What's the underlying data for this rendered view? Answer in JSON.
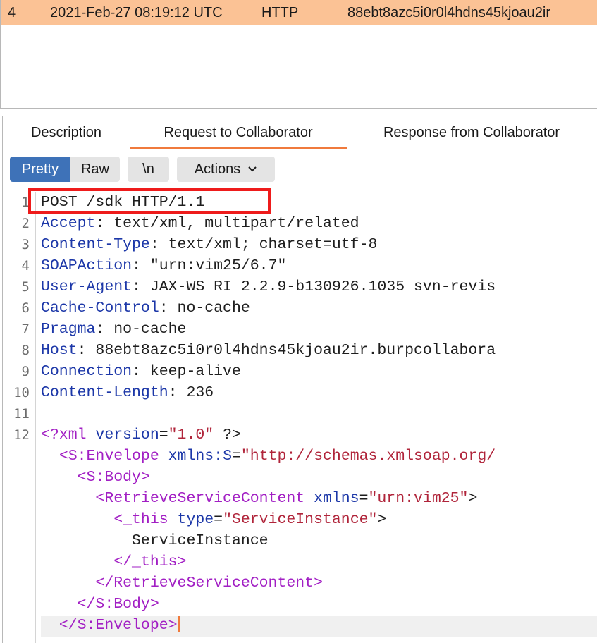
{
  "interactions": {
    "selected_row": {
      "number": "4",
      "time": "2021-Feb-27 08:19:12 UTC",
      "type": "HTTP",
      "payload": "88ebt8azc5i0r0l4hdns45kjoau2ir"
    }
  },
  "tabs": {
    "description": "Description",
    "request": "Request to Collaborator",
    "response": "Response from Collaborator",
    "active": "request"
  },
  "toolbar": {
    "pretty": "Pretty",
    "raw": "Raw",
    "newline": "\\n",
    "actions": "Actions"
  },
  "request": {
    "line_numbers": [
      "1",
      "2",
      "3",
      "4",
      "5",
      "6",
      "7",
      "8",
      "9",
      "10",
      "11",
      "12"
    ],
    "request_line": "POST /sdk HTTP/1.1",
    "headers": [
      {
        "name": "Accept",
        "value": " text/xml, multipart/related"
      },
      {
        "name": "Content-Type",
        "value": " text/xml; charset=utf-8"
      },
      {
        "name": "SOAPAction",
        "value": " \"urn:vim25/6.7\""
      },
      {
        "name": "User-Agent",
        "value": " JAX-WS RI 2.2.9-b130926.1035 svn-revis"
      },
      {
        "name": "Cache-Control",
        "value": " no-cache"
      },
      {
        "name": "Pragma",
        "value": " no-cache"
      },
      {
        "name": "Host",
        "value": " 88ebt8azc5i0r0l4hdns45kjoau2ir.burpcollabora"
      },
      {
        "name": "Connection",
        "value": " keep-alive"
      },
      {
        "name": "Content-Length",
        "value": " 236"
      }
    ],
    "body": {
      "xml_decl": {
        "open": "<?xml",
        "attr": "version",
        "value": "\"1.0\"",
        "close": " ?>"
      },
      "envelope_open": {
        "tag": "<S:Envelope",
        "attr": "xmlns:S",
        "value": "\"http://schemas.xmlsoap.org/"
      },
      "body_open": "<S:Body>",
      "retrieve_open": {
        "tag": "<RetrieveServiceContent",
        "attr": "xmlns",
        "value": "\"urn:vim25\"",
        "close": ">"
      },
      "this_open": {
        "tag": "<_this",
        "attr": "type",
        "value": "\"ServiceInstance\"",
        "close": ">"
      },
      "this_text": "ServiceInstance",
      "this_close": "</_this>",
      "retrieve_close": "</RetrieveServiceContent>",
      "body_close": "</S:Body>",
      "envelope_close": "</S:Envelope>"
    }
  },
  "colors": {
    "selection_row": "#fbc295",
    "active_tab_underline": "#f07a3c",
    "pretty_button": "#3e72b8",
    "highlight_box": "#ee1b1b",
    "header_name": "#1c37a8",
    "xml_tag": "#a21fc4",
    "xml_string": "#b0243a"
  }
}
